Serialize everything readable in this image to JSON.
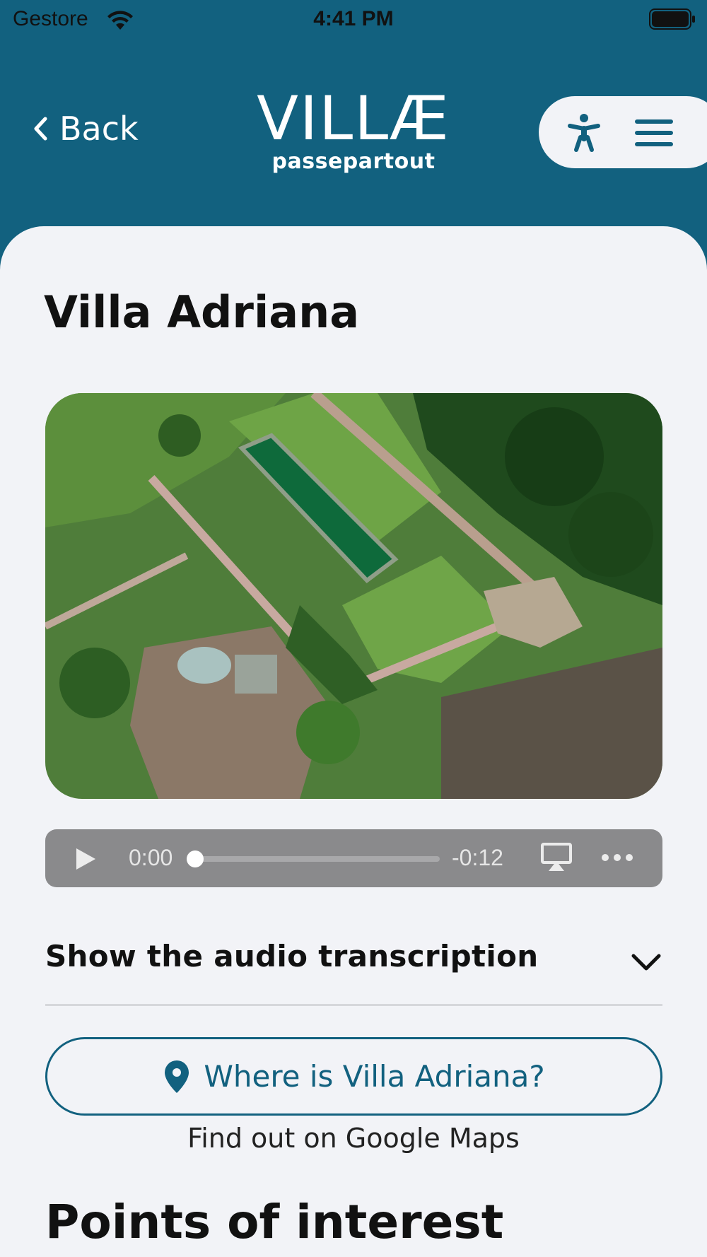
{
  "status_bar": {
    "carrier": "Gestore",
    "time": "4:41 PM",
    "wifi_icon": "wifi-icon",
    "battery_icon": "battery-full-icon"
  },
  "header": {
    "back_label": "Back",
    "logo_main": "VILLÆ",
    "logo_sub": "passepartout",
    "accessibility_icon": "accessibility-icon",
    "menu_icon": "hamburger-menu-icon"
  },
  "colors": {
    "primary": "#12617f",
    "background": "#f2f3f7",
    "player": "#8a8a8c"
  },
  "page": {
    "title": "Villa Adriana"
  },
  "audio_player": {
    "current_time": "0:00",
    "remaining_time": "-0:12",
    "progress": 0.0,
    "play_icon": "play-icon",
    "airplay_icon": "airplay-icon",
    "more_icon": "more-options-icon"
  },
  "transcription": {
    "label": "Show the audio transcription",
    "expanded": false
  },
  "map": {
    "button_label": "Where is Villa Adriana?",
    "caption": "Find out on Google Maps",
    "pin_icon": "map-pin-icon"
  },
  "sections": {
    "points_of_interest": "Points of interest"
  }
}
